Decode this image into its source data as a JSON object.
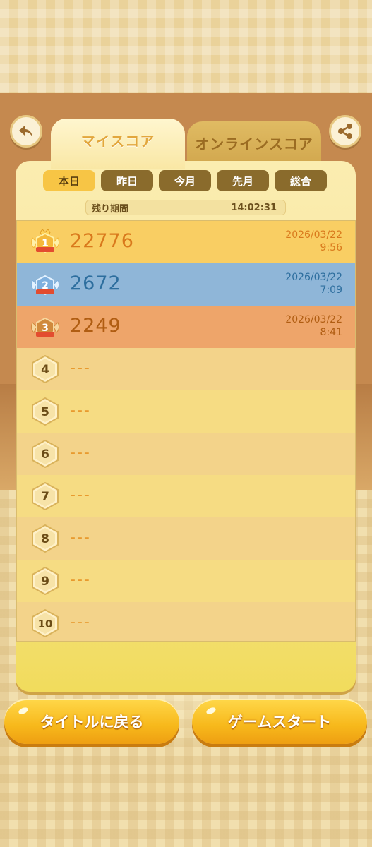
{
  "tabs": {
    "my_score": "マイスコア",
    "online_score": "オンラインスコア"
  },
  "periods": [
    "本日",
    "昨日",
    "今月",
    "先月",
    "総合"
  ],
  "active_period": 0,
  "remaining": {
    "label": "残り期間",
    "time": "14:02:31"
  },
  "rankings": [
    {
      "rank": "1",
      "score": "22776",
      "date": "2026/03/22",
      "time": "9:56"
    },
    {
      "rank": "2",
      "score": "2672",
      "date": "2026/03/22",
      "time": "7:09"
    },
    {
      "rank": "3",
      "score": "2249",
      "date": "2026/03/22",
      "time": "8:41"
    },
    {
      "rank": "4",
      "score": "---",
      "date": "",
      "time": ""
    },
    {
      "rank": "5",
      "score": "---",
      "date": "",
      "time": ""
    },
    {
      "rank": "6",
      "score": "---",
      "date": "",
      "time": ""
    },
    {
      "rank": "7",
      "score": "---",
      "date": "",
      "time": ""
    },
    {
      "rank": "8",
      "score": "---",
      "date": "",
      "time": ""
    },
    {
      "rank": "9",
      "score": "---",
      "date": "",
      "time": ""
    },
    {
      "rank": "10",
      "score": "---",
      "date": "",
      "time": ""
    }
  ],
  "buttons": {
    "back_to_title": "タイトルに戻る",
    "game_start": "ゲームスタート"
  },
  "icons": {
    "back": "back-arrow-icon",
    "share": "share-icon",
    "rank_gold": "gold-medal-icon",
    "rank_silver": "silver-medal-icon",
    "rank_bronze": "bronze-medal-icon",
    "rank_plain": "hexagon-rank-icon"
  },
  "colors": {
    "gold_row": "#f9ce63",
    "silver_row": "#8fb6d8",
    "bronze_row": "#eea56a",
    "gold_text": "#d9791c",
    "silver_text": "#2d6e9e",
    "bronze_text": "#b05d12",
    "empty_row_a": "#f6dc83",
    "empty_row_b": "#f3d38a"
  }
}
